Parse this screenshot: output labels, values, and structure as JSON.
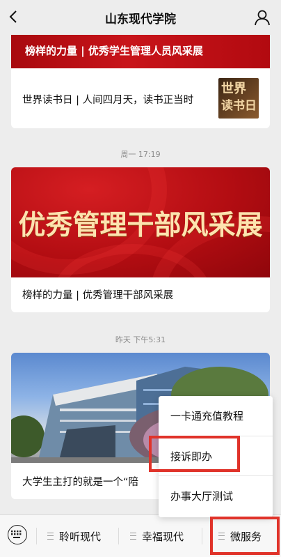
{
  "header": {
    "title": "山东现代学院"
  },
  "feed": {
    "card1": {
      "banner_title": "榜样的力量 | 优秀学生管理人员风采展",
      "item_text": "世界读书日 | 人间四月天，读书正当时",
      "thumb_line1": "世界",
      "thumb_line2": "读书日"
    },
    "timestamp1": "周一 17:19",
    "card2": {
      "hero_text": "优秀管理干部风采展",
      "caption": "榜样的力量 | 优秀管理干部风采展"
    },
    "timestamp2": "昨天 下午5:31",
    "card3": {
      "caption": "大学生主打的就是一个“陪"
    }
  },
  "popup_menu": {
    "items": [
      {
        "label": "一卡通充值教程"
      },
      {
        "label": "接诉即办"
      },
      {
        "label": "办事大厅测试"
      }
    ]
  },
  "bottom_bar": {
    "tabs": [
      {
        "label": "聆听现代"
      },
      {
        "label": "幸福现代"
      },
      {
        "label": "微服务"
      }
    ]
  },
  "colors": {
    "accent_red": "#e0332a",
    "banner_red": "#c8141a"
  }
}
